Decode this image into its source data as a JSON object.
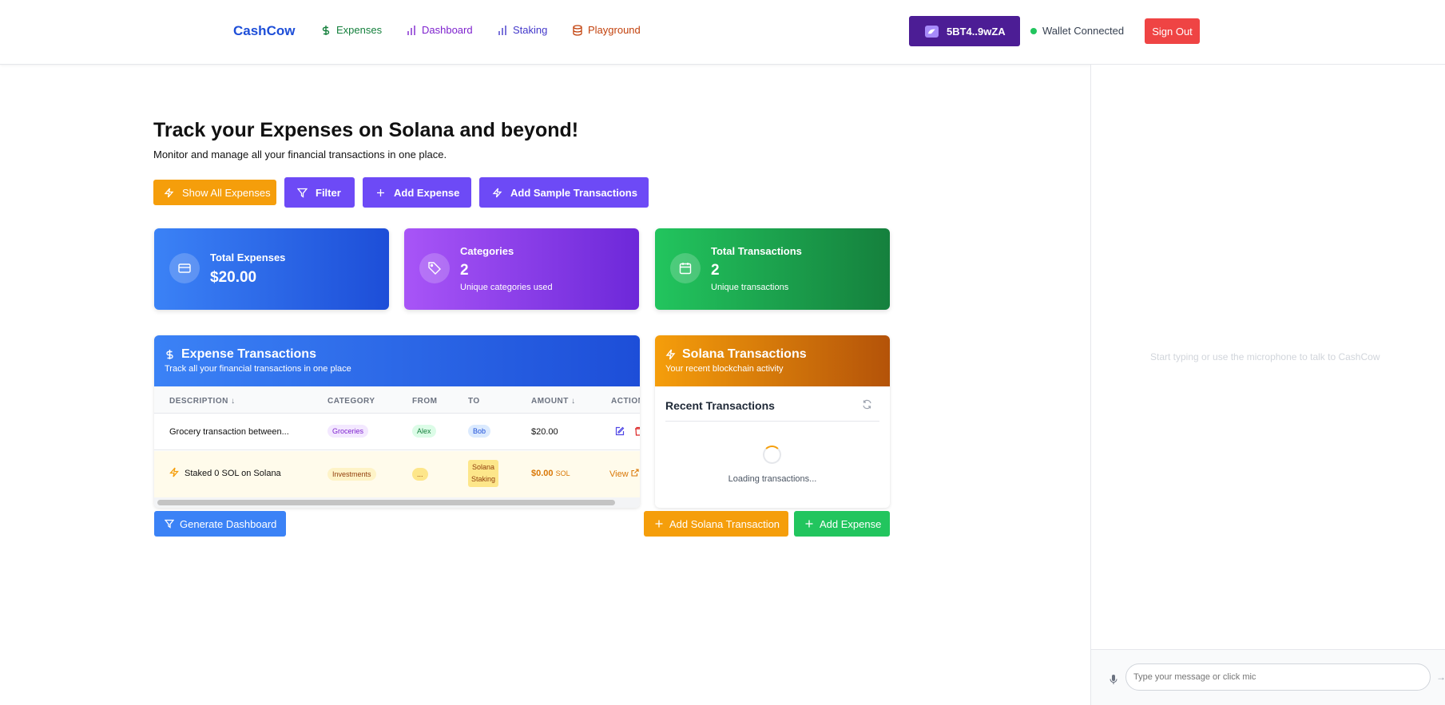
{
  "nav": {
    "brand": "CashCow",
    "items": [
      {
        "label": "Expenses",
        "icon": "dollar-icon",
        "color": "#15803d"
      },
      {
        "label": "Dashboard",
        "icon": "bar-chart-icon",
        "color": "#7e22ce"
      },
      {
        "label": "Staking",
        "icon": "bar-chart-icon",
        "color": "#4338ca"
      },
      {
        "label": "Playground",
        "icon": "database-icon",
        "color": "#c2410c"
      }
    ],
    "wallet_address": "5BT4..9wZA",
    "wallet_status": "Wallet Connected",
    "sign_out": "Sign Out"
  },
  "hero": {
    "title": "Track your Expenses on Solana and beyond!",
    "subtitle": "Monitor and manage all your financial transactions in one place."
  },
  "actions": {
    "show_all": "Show All Expenses",
    "filter": "Filter",
    "add_expense": "Add Expense",
    "add_sample": "Add Sample Transactions"
  },
  "stats": {
    "total_expenses": {
      "label": "Total Expenses",
      "value": "$20.00"
    },
    "categories": {
      "label": "Categories",
      "value": "2",
      "note": "Unique categories used"
    },
    "total_transactions": {
      "label": "Total Transactions",
      "value": "2",
      "note": "Unique transactions"
    }
  },
  "expense_table": {
    "title": "Expense Transactions",
    "subtitle": "Track all your financial transactions in one place",
    "columns": [
      "DESCRIPTION",
      "CATEGORY",
      "FROM",
      "TO",
      "AMOUNT",
      "ACTION"
    ],
    "rows": [
      {
        "description": "Grocery transaction between...",
        "category": "Groceries",
        "from": "Alex",
        "to": "Bob",
        "amount": "$20.00"
      },
      {
        "description": "Staked 0 SOL on Solana",
        "category": "Investments",
        "from": "...",
        "to_line1": "Solana",
        "to_line2": "Staking",
        "amount": "$0.00",
        "amount_unit": "SOL",
        "action": "View"
      }
    ]
  },
  "solana": {
    "title": "Solana Transactions",
    "subtitle": "Your recent blockchain activity",
    "recent_title": "Recent Transactions",
    "loading": "Loading transactions..."
  },
  "bottom_actions": {
    "generate_dashboard": "Generate Dashboard",
    "add_solana": "Add Solana Transaction",
    "add_expense": "Add Expense"
  },
  "chat": {
    "empty_hint": "Start typing or use the microphone to talk to CashCow",
    "placeholder": "Type your message or click mic"
  }
}
